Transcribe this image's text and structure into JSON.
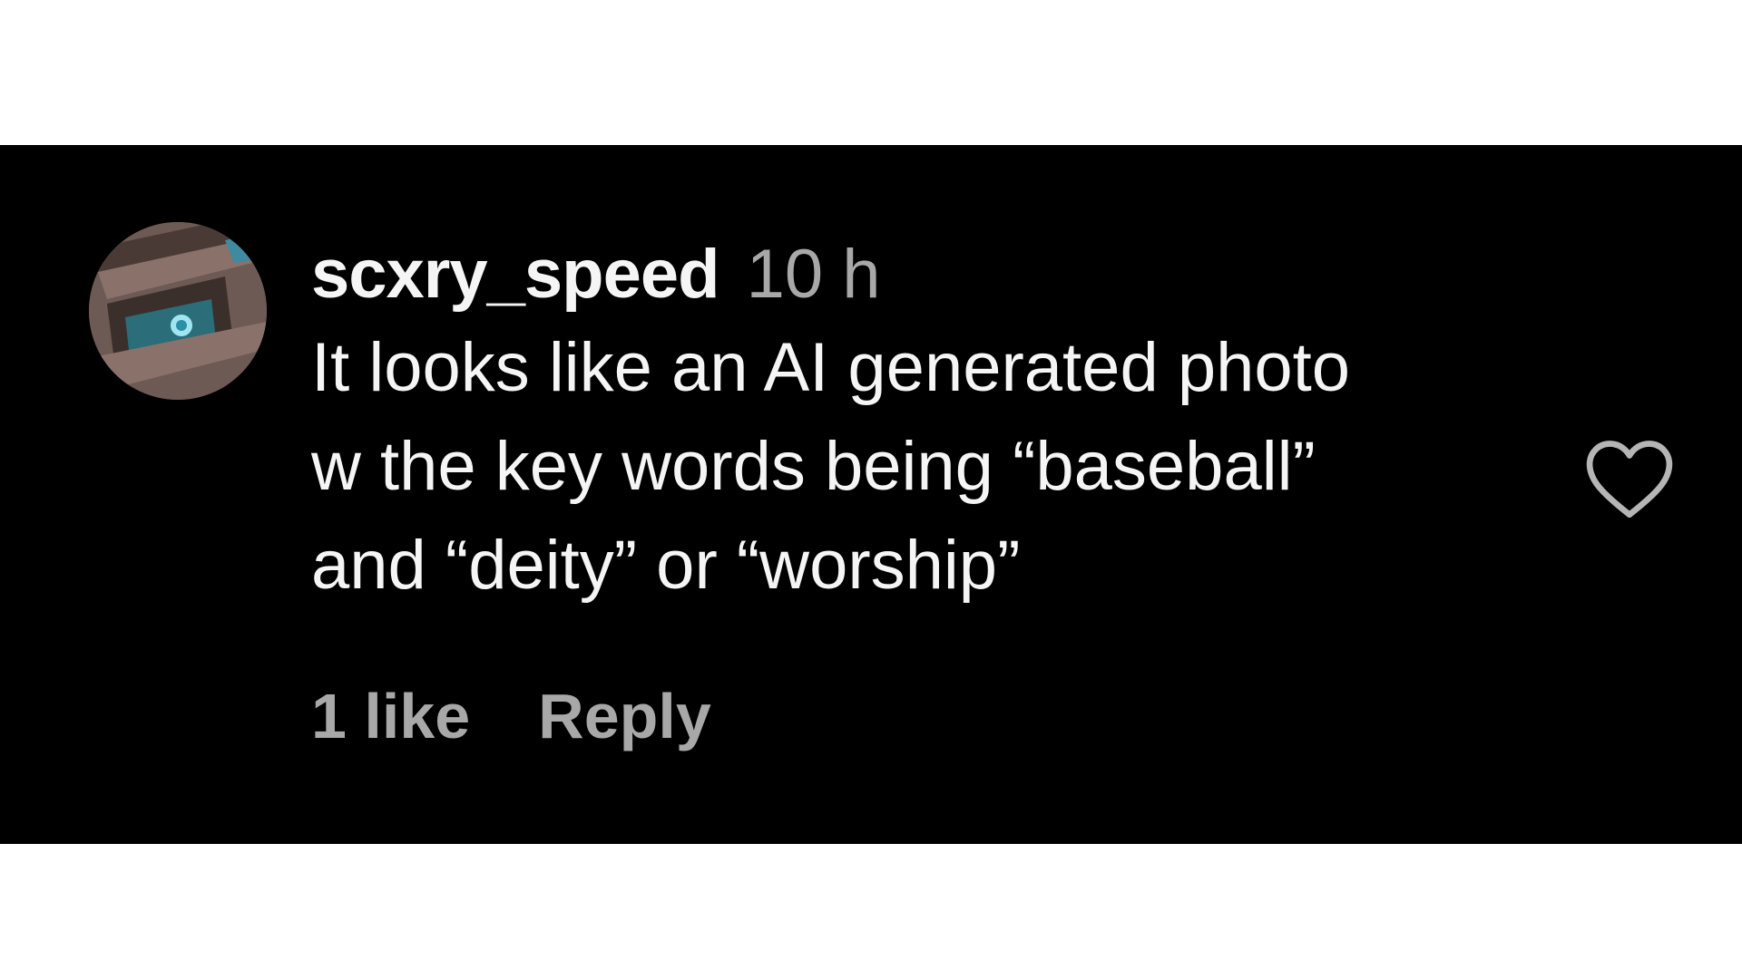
{
  "comment": {
    "username": "scxry_speed",
    "timestamp": "10 h",
    "text_lines": [
      "It looks like an AI generated photo",
      "w the key words being “baseball”",
      "and “deity” or “worship”"
    ],
    "likes_label": "1 like",
    "reply_label": "Reply",
    "like_icon": "heart-outline-icon"
  },
  "colors": {
    "background": "#000000",
    "primary_text": "#f5f5f5",
    "secondary_text": "#a8a8a8",
    "page_margin": "#ffffff"
  }
}
